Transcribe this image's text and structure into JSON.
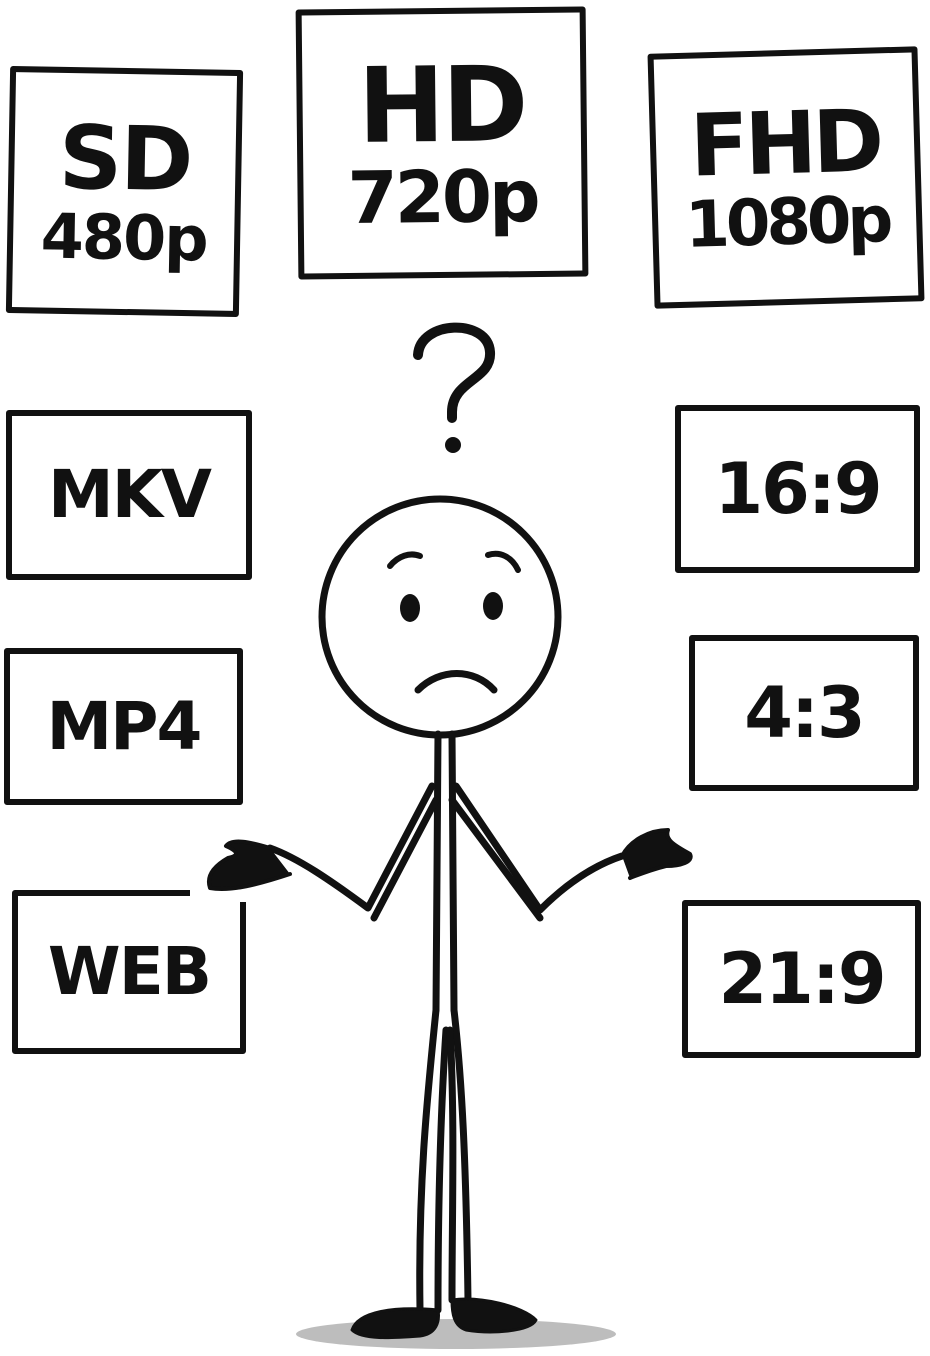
{
  "labels": {
    "sd": {
      "line1": "SD",
      "line2": "480p"
    },
    "hd": {
      "line1": "HD",
      "line2": "720p"
    },
    "fhd": {
      "line1": "FHD",
      "line2": "1080p"
    },
    "mkv": {
      "line1": "MKV"
    },
    "mp4": {
      "line1": "MP4"
    },
    "web": {
      "line1": "WEB"
    },
    "r169": {
      "line1": "16:9"
    },
    "r43": {
      "line1": "4:3"
    },
    "r219": {
      "line1": "21:9"
    }
  },
  "thought": {
    "symbol": "?"
  },
  "figure": {
    "expression": "confused",
    "pose": "shrug"
  },
  "colors": {
    "ink": "#111111",
    "background": "#ffffff",
    "shadow": "#bdbdbd"
  }
}
